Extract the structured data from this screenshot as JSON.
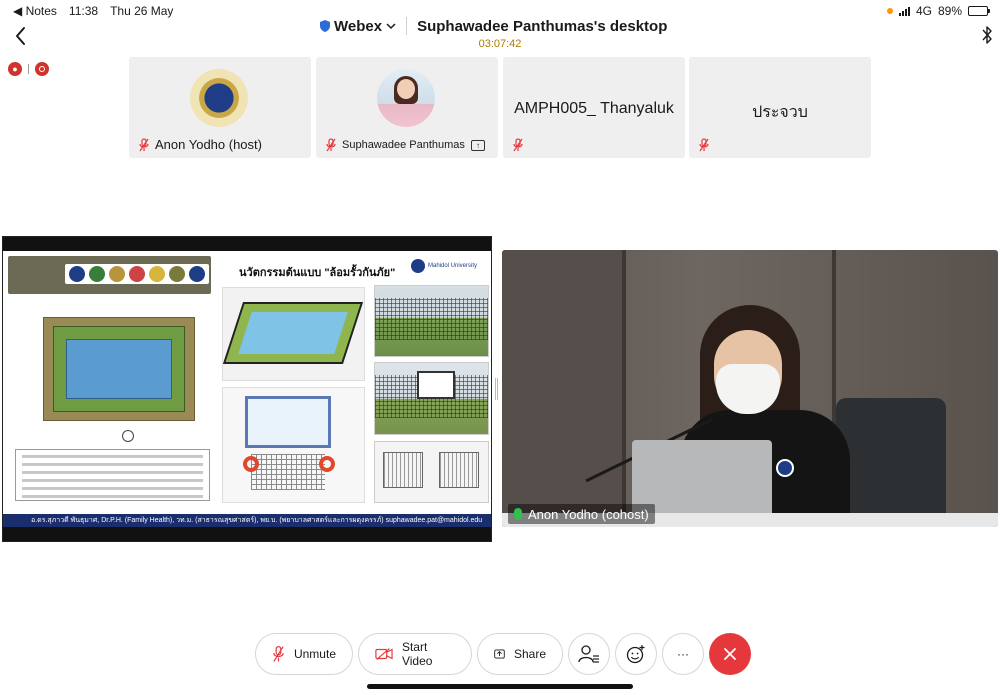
{
  "status_bar": {
    "back_app": "◀ Notes",
    "time": "11:38",
    "date": "Thu 26 May",
    "network": "4G",
    "battery": "89%",
    "battery_level": 0.89
  },
  "header": {
    "app_name": "Webex",
    "title": "Suphawadee Panthumas's desktop",
    "elapsed": "03:07:42"
  },
  "participants": [
    {
      "name": "Anon Yodho (host)",
      "muted": true,
      "visual": "seal"
    },
    {
      "name": "Suphawadee Panthumas",
      "muted": true,
      "sharing": true,
      "visual": "avatar"
    },
    {
      "name": "AMPH005_ Thanyaluk",
      "muted": true,
      "visual": "text"
    },
    {
      "name": "ประจวบ",
      "muted": true,
      "visual": "text"
    }
  ],
  "shared_slide": {
    "title": "นวัตกรรมต้นแบบ \"ล้อมรั้วกันภัย\"",
    "institution": "Mahidol University",
    "footer": "อ.ดร.สุภาวดี พันธุมาศ, Dr.P.H. (Family Health), วท.ม. (สาธารณสุขศาสตร์), พย.บ. (พยาบาลศาสตร์และการผดุงครรภ์) suphawadee.pat@mahidol.edu"
  },
  "video": {
    "name": "Anon Yodho (cohost)",
    "mic_active": true
  },
  "controls": {
    "unmute": "Unmute",
    "start_video": "Start Video",
    "share": "Share",
    "participants_icon": "participants-icon",
    "reactions_icon": "reactions-icon",
    "more": "···",
    "end_icon": "close-icon"
  },
  "colors": {
    "end_call": "#e5383d",
    "timer": "#b07a00",
    "record_indicator": "#d0332d",
    "active_mic": "#2fc14f"
  }
}
